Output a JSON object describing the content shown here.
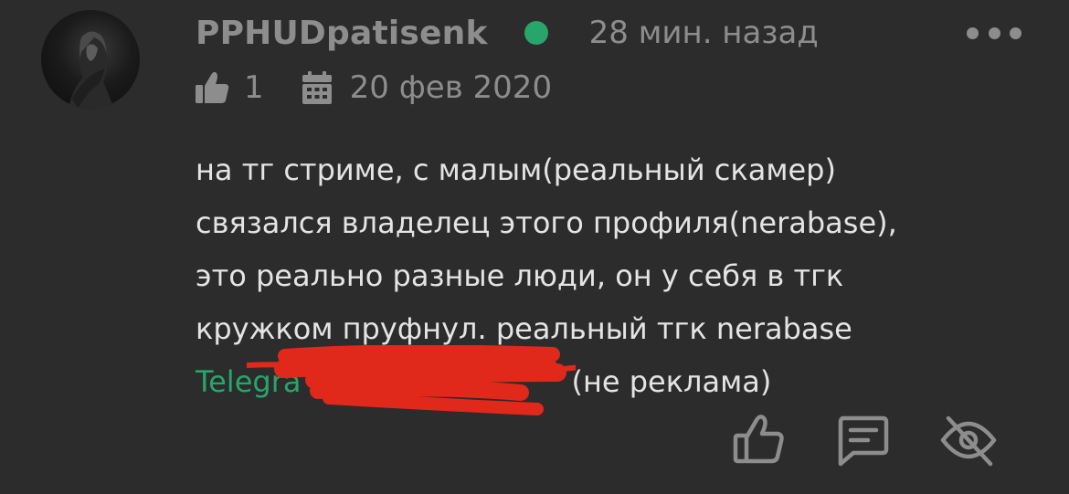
{
  "comment": {
    "author": "PPHUDpatisenk",
    "status": "online",
    "time_ago": "28 мин. назад",
    "likes": "1",
    "date": "20 фев 2020",
    "text_lines": [
      "на тг стриме, с малым(реальный скамер)",
      "связался владелец этого профиля(nerabase),",
      "это реально разные люди, он у себя в тгк",
      "кружком пруфнул. реальный тгк nerabase"
    ],
    "link_visible_text": "Telegra",
    "link_suffix": "(не реклама)",
    "redaction_color": "#e0281b"
  },
  "icons": {
    "avatar": "avatar",
    "more": "more-dots-icon",
    "likes": "thumbs-up-icon",
    "date": "calendar-icon",
    "like_action": "thumbs-up-outline-icon",
    "reply_action": "comment-icon",
    "hide_action": "eye-off-icon"
  },
  "colors": {
    "background": "#2c2c2c",
    "muted_text": "#8d8d8d",
    "body_text": "#e4e4e4",
    "accent_green": "#27a56a"
  }
}
